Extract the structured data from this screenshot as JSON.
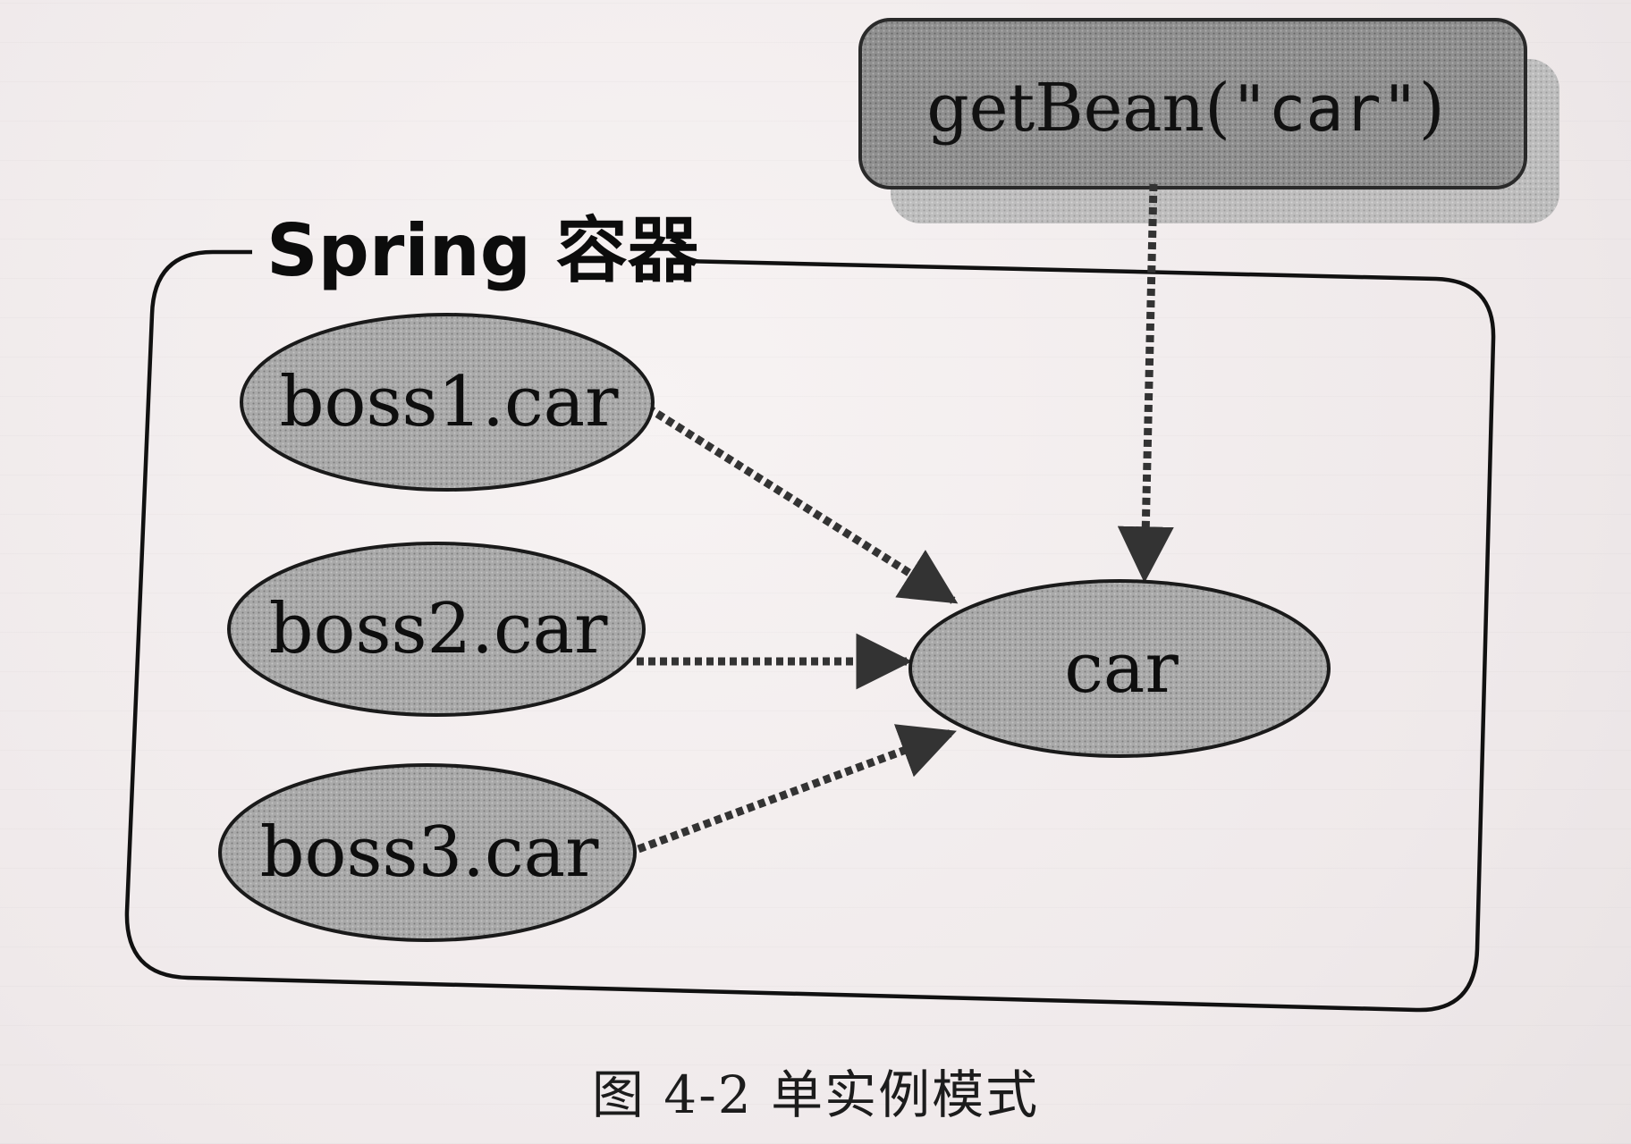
{
  "container": {
    "title": "Spring 容器"
  },
  "call": {
    "label_prefix": "getBean(",
    "label_arg": "\"car\"",
    "label_suffix": ")"
  },
  "nodes": {
    "boss1": "boss1.car",
    "boss2": "boss2.car",
    "boss3": "boss3.car",
    "car": "car"
  },
  "caption": "图 4-2    单实例模式"
}
